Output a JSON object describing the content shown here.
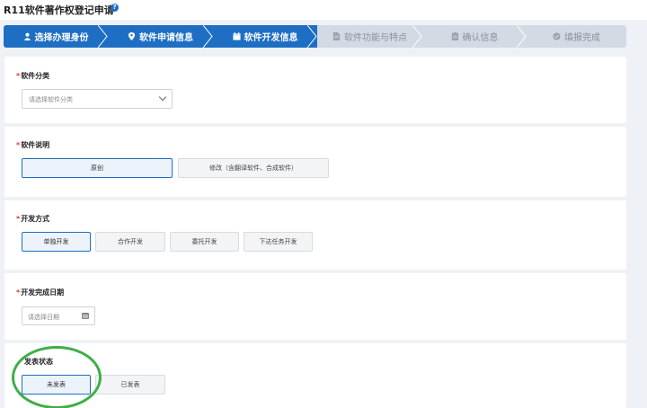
{
  "header": {
    "title": "R11软件著作权登记申请",
    "help_icon": "question-circle-icon"
  },
  "steps": [
    {
      "label": "选择办理身份",
      "icon": "user-icon",
      "active": true
    },
    {
      "label": "软件申请信息",
      "icon": "location-pin-icon",
      "active": true
    },
    {
      "label": "软件开发信息",
      "icon": "calendar-icon",
      "active": true
    },
    {
      "label": "软件功能与特点",
      "icon": "document-icon",
      "active": false
    },
    {
      "label": "确认信息",
      "icon": "clipboard-icon",
      "active": false
    },
    {
      "label": "填报完成",
      "icon": "check-circle-icon",
      "active": false
    }
  ],
  "sections": {
    "category": {
      "required": "*",
      "label": "软件分类",
      "placeholder": "请选择软件分类"
    },
    "description": {
      "required": "*",
      "label": "软件说明",
      "options": [
        "原创",
        "修改（含翻译软件、合成软件）"
      ],
      "selected": "原创"
    },
    "dev_method": {
      "required": "*",
      "label": "开发方式",
      "options": [
        "单独开发",
        "合作开发",
        "委托开发",
        "下达任务开发"
      ],
      "selected": "单独开发"
    },
    "completion_date": {
      "required": "*",
      "label": "开发完成日期",
      "placeholder": "请选择日期"
    },
    "publish_status": {
      "label": "发表状态",
      "options": [
        "未发表",
        "已发表"
      ],
      "selected": "未发表"
    }
  },
  "colors": {
    "primary": "#1e6fc4",
    "annotation": "#3fae49",
    "required": "#e0392c"
  }
}
